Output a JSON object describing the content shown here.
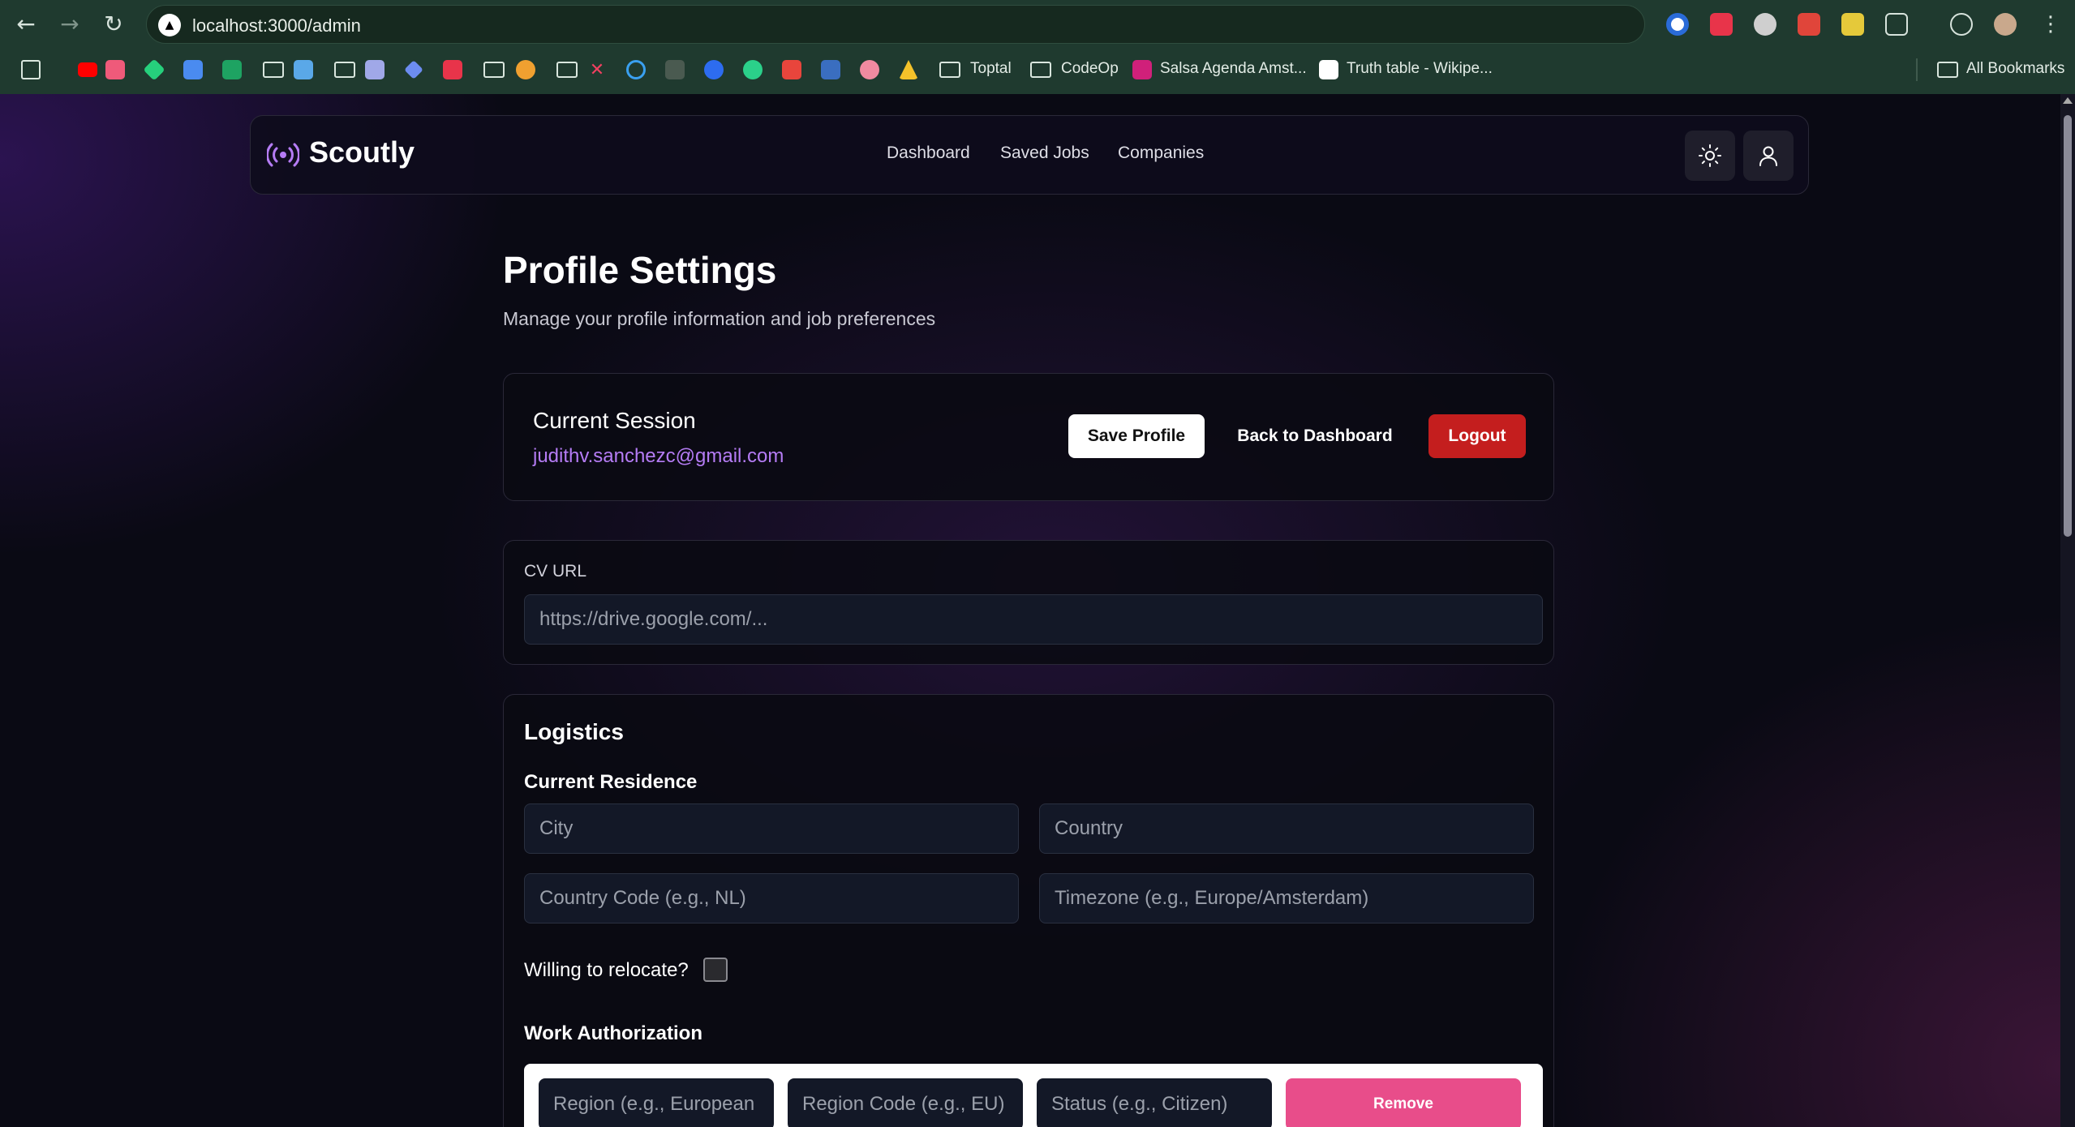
{
  "browser": {
    "url": "localhost:3000/admin",
    "bookmarks": {
      "toptal": "Toptal",
      "codeop": "CodeOp",
      "salsa": "Salsa Agenda Amst...",
      "truth_table": "Truth table - Wikipe...",
      "all_bookmarks": "All Bookmarks"
    }
  },
  "nav": {
    "brand": "Scoutly",
    "links": [
      "Dashboard",
      "Saved Jobs",
      "Companies"
    ]
  },
  "header": {
    "title": "Profile Settings",
    "subtitle": "Manage your profile information and job preferences"
  },
  "session": {
    "title": "Current Session",
    "email": "judithv.sanchezc@gmail.com",
    "save_label": "Save Profile",
    "back_label": "Back to Dashboard",
    "logout_label": "Logout"
  },
  "cv": {
    "label": "CV URL",
    "placeholder": "https://drive.google.com/..."
  },
  "logistics": {
    "title": "Logistics",
    "residence_title": "Current Residence",
    "city_placeholder": "City",
    "country_placeholder": "Country",
    "country_code_placeholder": "Country Code (e.g., NL)",
    "timezone_placeholder": "Timezone (e.g., Europe/Amsterdam)",
    "relocate_label": "Willing to relocate?",
    "relocate_checked": false,
    "work_auth_title": "Work Authorization",
    "region_placeholder": "Region (e.g., European",
    "region_code_placeholder": "Region Code (e.g., EU)",
    "status_placeholder": "Status (e.g., Citizen)",
    "remove_label": "Remove"
  },
  "colors": {
    "accent_purple": "#b57cf5",
    "logout_red": "#c41e1e",
    "remove_pink": "#e84d8a"
  }
}
